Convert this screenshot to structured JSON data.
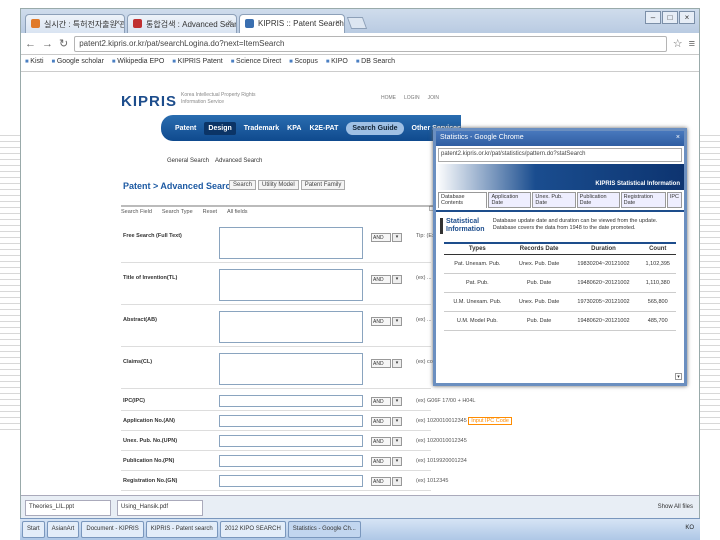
{
  "browser": {
    "tabs": [
      {
        "label": "실시간 : 특허전자출원 관련 참",
        "color": "#e07a2a"
      },
      {
        "label": "통합검색 : Advanced Search",
        "color": "#c03030"
      },
      {
        "label": "KIPRIS :: Patent Search",
        "color": "#3a6fb0"
      }
    ],
    "address": "patent2.kipris.or.kr/pat/searchLogina.do?next=ItemSearch",
    "bookmarks": [
      "Kisti",
      "Google scholar",
      "Wikipedia EPO",
      "KIPRIS Patent",
      "Science Direct",
      "Scopus",
      "KIPO",
      "DB Search"
    ]
  },
  "site": {
    "logo": "KIPRIS",
    "logo_sub": "Korea Intellectual Property Rights Information Service",
    "top_links": [
      "HOME",
      "LOGIN",
      "JOIN"
    ],
    "menu": [
      "Patent",
      "Design",
      "Trademark",
      "KPA",
      "K2E-PAT",
      "Search Guide",
      "Other Services"
    ],
    "submenu": [
      "General Search",
      "Advanced Search"
    ],
    "title": "Patent > Advanced Search",
    "ptabs": [
      "Search",
      "Utility Model",
      "Patent Family"
    ],
    "options": [
      "Search Field",
      "Search Type",
      "Reset",
      "All fields"
    ],
    "right_check": "B",
    "fields": [
      {
        "label": "Free Search (Full Text)",
        "hint": "Tip: (Ex)...",
        "tall": true
      },
      {
        "label": "Title of Invention(TL)",
        "hint": "(ex) ...",
        "tall": true
      },
      {
        "label": "Abstract(AB)",
        "hint": "(ex) ... dialogic",
        "tall": true
      },
      {
        "label": "Claims(CL)",
        "hint": "(ex) cod ... * dialogic",
        "tall": true
      },
      {
        "label": "IPC(IPC)",
        "hint": "(ex) G06F 17/00 + H04L",
        "tall": false
      },
      {
        "label": "Application No.(AN)",
        "hint": "(ex) 1020010012345",
        "hl": "Input IPC Code",
        "tall": false
      },
      {
        "label": "Unex. Pub. No.(UPN)",
        "hint": "(ex) 1020010012345",
        "tall": false
      },
      {
        "label": "Publication No.(PN)",
        "hint": "(ex) 1019920001234",
        "tall": false
      },
      {
        "label": "Registration No.(GN)",
        "hint": "(ex) 1012345",
        "tall": false
      }
    ],
    "select_default": "AND"
  },
  "statistics": {
    "window_title": "Statistics - Google Chrome",
    "url": "patent2.kipris.or.kr/pat/statistics/pattern.do?statSearch",
    "band_label": "KIPRIS Statistical Information",
    "tabs": [
      "Database Contents",
      "Application Date",
      "Unex. Pub. Date",
      "Publication Date",
      "Registration Date",
      "IPC"
    ],
    "logo": "Statistical Information",
    "desc": "Database update date and duration can be viewed from the update. Database covers the data from 1948 to the date promoted.",
    "columns": [
      "Types",
      "Records Date",
      "Duration",
      "Count"
    ],
    "rows": [
      [
        "Pat. Unexam. Pub.",
        "Unex. Pub. Date",
        "19830204~20121002",
        "1,102,395"
      ],
      [
        "Pat. Pub.",
        "Pub. Date",
        "19480620~20121002",
        "1,110,380"
      ],
      [
        "U.M. Unexam. Pub.",
        "Unex. Pub. Date",
        "19730205~20121002",
        "565,800"
      ],
      [
        "U.M. Model Pub.",
        "Pub. Date",
        "19480620~20121002",
        "485,700"
      ]
    ]
  },
  "downloads": {
    "items": [
      "Theories_LIL.ppt",
      "Using_Hansik.pdf"
    ],
    "right": "Show All files"
  },
  "taskbar": {
    "items": [
      "Start",
      "AsianArt",
      "Document - KIPRIS",
      "KIPRIS - Patent search",
      "2012 KIPO SEARCH",
      "Statistics - Google Ch..."
    ],
    "tray": "KO"
  }
}
